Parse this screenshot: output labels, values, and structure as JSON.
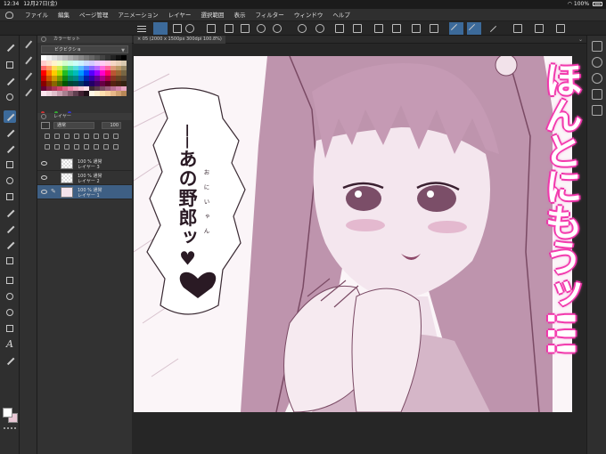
{
  "status": {
    "time": "12:34",
    "date": "12月27日(金)",
    "wifi_icon": "wifi-icon",
    "battery_percent": "100%"
  },
  "menu": {
    "items": [
      "ファイル",
      "編集",
      "ページ管理",
      "アニメーション",
      "レイヤー",
      "選択範囲",
      "表示",
      "フィルター",
      "ウィンドウ",
      "ヘルプ"
    ]
  },
  "palette": {
    "color_set_title": "カラーセット",
    "color_set_name": "ビクビクショ",
    "swatch_colors": [
      "#ffffff",
      "#eeeeee",
      "#dddddd",
      "#cccccc",
      "#bbbbbb",
      "#aaaaaa",
      "#999999",
      "#888888",
      "#777777",
      "#666666",
      "#555555",
      "#444444",
      "#333333",
      "#222222",
      "#111111",
      "#000000",
      "#ffcccc",
      "#ffe0cc",
      "#fff4cc",
      "#f0ffcc",
      "#d4ffcc",
      "#ccffe4",
      "#ccfff8",
      "#ccf0ff",
      "#ccdcff",
      "#d4ccff",
      "#ecccff",
      "#ffccf4",
      "#ffcce0",
      "#f5d6c6",
      "#e8d0b8",
      "#d8c8b0",
      "#ff6666",
      "#ff9966",
      "#ffdd55",
      "#ccee55",
      "#77dd66",
      "#55ddaa",
      "#55dddd",
      "#55bbff",
      "#5588ff",
      "#8866ff",
      "#bb66ff",
      "#ff66dd",
      "#ff6699",
      "#dd9977",
      "#bb9966",
      "#998866",
      "#ff0000",
      "#ff7700",
      "#ffcc00",
      "#aadd00",
      "#22bb22",
      "#00bb88",
      "#00bbbb",
      "#0099ff",
      "#0044ff",
      "#5500ff",
      "#9900ff",
      "#ff00cc",
      "#ff0066",
      "#bb5533",
      "#996633",
      "#776644",
      "#cc0000",
      "#cc5500",
      "#cc9900",
      "#779900",
      "#118811",
      "#008866",
      "#008888",
      "#0066cc",
      "#0022aa",
      "#3300aa",
      "#660099",
      "#aa0088",
      "#aa0044",
      "#883322",
      "#664422",
      "#554433",
      "#880000",
      "#883300",
      "#886600",
      "#446600",
      "#005500",
      "#004433",
      "#004444",
      "#003366",
      "#001166",
      "#220066",
      "#440066",
      "#660044",
      "#550022",
      "#552211",
      "#442211",
      "#332211",
      "#660033",
      "#882244",
      "#aa3355",
      "#cc4466",
      "#dd6688",
      "#ee88aa",
      "#f4aac4",
      "#f8c8d8",
      "#fce0ea",
      "#3c2a34",
      "#5a3a4a",
      "#7a4a62",
      "#9a5a7a",
      "#b86e92",
      "#d284aa",
      "#e8a4c2",
      "#ffe8f0",
      "#f0d8e0",
      "#e0c0cc",
      "#c8a0b0",
      "#a88090",
      "#886070",
      "#604050",
      "#402030",
      "#201018",
      "#fff8e8",
      "#fff0d0",
      "#ffe0b0",
      "#f8d0a0",
      "#e8b888",
      "#d0a070",
      "#b88858"
    ],
    "layer_title": "レイヤー",
    "blend_mode": "通常",
    "opacity": "100",
    "layers": [
      {
        "line1": "100 % 通常",
        "line2": "レイヤー 3"
      },
      {
        "line1": "100 % 通常",
        "line2": "レイヤー 2"
      },
      {
        "line1": "100 % 通常",
        "line2": "レイヤー 1"
      }
    ]
  },
  "document": {
    "tab_label": "05 (2000 x 1500px 300dpi 100.8%)"
  },
  "artwork": {
    "bubble_text": "──あの野郎ッ♥",
    "ruby_text": "おにいゃん",
    "shout_text": "ほんとにもうッ!!!"
  },
  "colors": {
    "accent": "#3c6a9a",
    "canvas_tint": "#fbf5f8",
    "ink": "#2a1a24",
    "shout_glow": "#ff3fb4"
  }
}
